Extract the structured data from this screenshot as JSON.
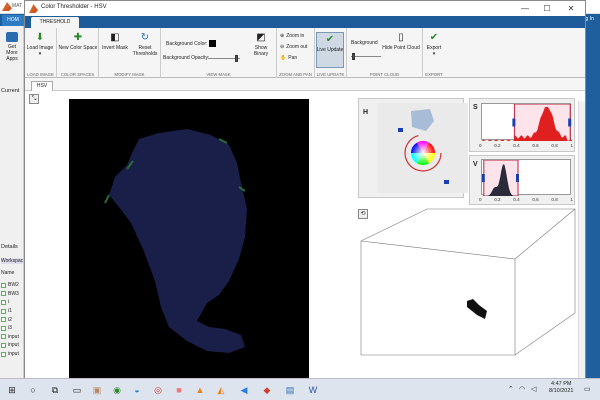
{
  "background_app": {
    "title": "MAT",
    "tab": "HOM",
    "get_more_apps": "Get More Apps",
    "login": "Log In",
    "current_folder": "Current",
    "details": "Details",
    "workspace": "Workspac",
    "name_col": "Name",
    "workspace_vars": [
      "BW2",
      "BW3",
      "i",
      "i1",
      "i2",
      "i3",
      "input",
      "input",
      "input"
    ]
  },
  "window": {
    "title": "Color Thresholder - HSV",
    "minimize": "—",
    "maximize": "☐",
    "close": "✕"
  },
  "ribbon": {
    "tab": "THRESHOLD",
    "load_image": "Load Image",
    "new_color_space": "New Color Space",
    "invert_mask": "Invert Mask",
    "reset_thresholds": "Reset Thresholds",
    "background_color": "Background Color:",
    "background_opacity": "Background Opacity:",
    "show_binary": "Show Binary",
    "zoom_in": "Zoom in",
    "zoom_out": "Zoom out",
    "pan": "Pan",
    "live_update": "Live Update",
    "background": "Background",
    "hide_point_cloud": "Hide Point Cloud",
    "export": "Export",
    "sections": [
      "LOAD IMAGE",
      "COLOR SPACES",
      "MODIFY MASK",
      "VIEW MASK",
      "ZOOM AND PAN",
      "LIVE UPDATE",
      "POINT CLOUD",
      "EXPORT"
    ]
  },
  "document": {
    "tab": "HSV"
  },
  "controls": {
    "h_label": "H",
    "s_label": "S",
    "v_label": "V",
    "s_ticks": [
      "0",
      "0.2",
      "0.4",
      "0.6",
      "0.8",
      "1"
    ],
    "v_ticks": [
      "0",
      "0.2",
      "0.4",
      "0.6",
      "0.8",
      "1"
    ],
    "s_range": [
      0.36,
      0.98
    ],
    "v_range": [
      0.02,
      0.4
    ]
  },
  "taskbar": {
    "time": "4:47 PM",
    "date": "8/10/2021"
  },
  "colors": {
    "accent": "#1d5c99",
    "mask_color": "#1a1f4a",
    "s_hist": "#e02020",
    "v_hist": "#2a2a3a",
    "range_box": "#c02040"
  }
}
